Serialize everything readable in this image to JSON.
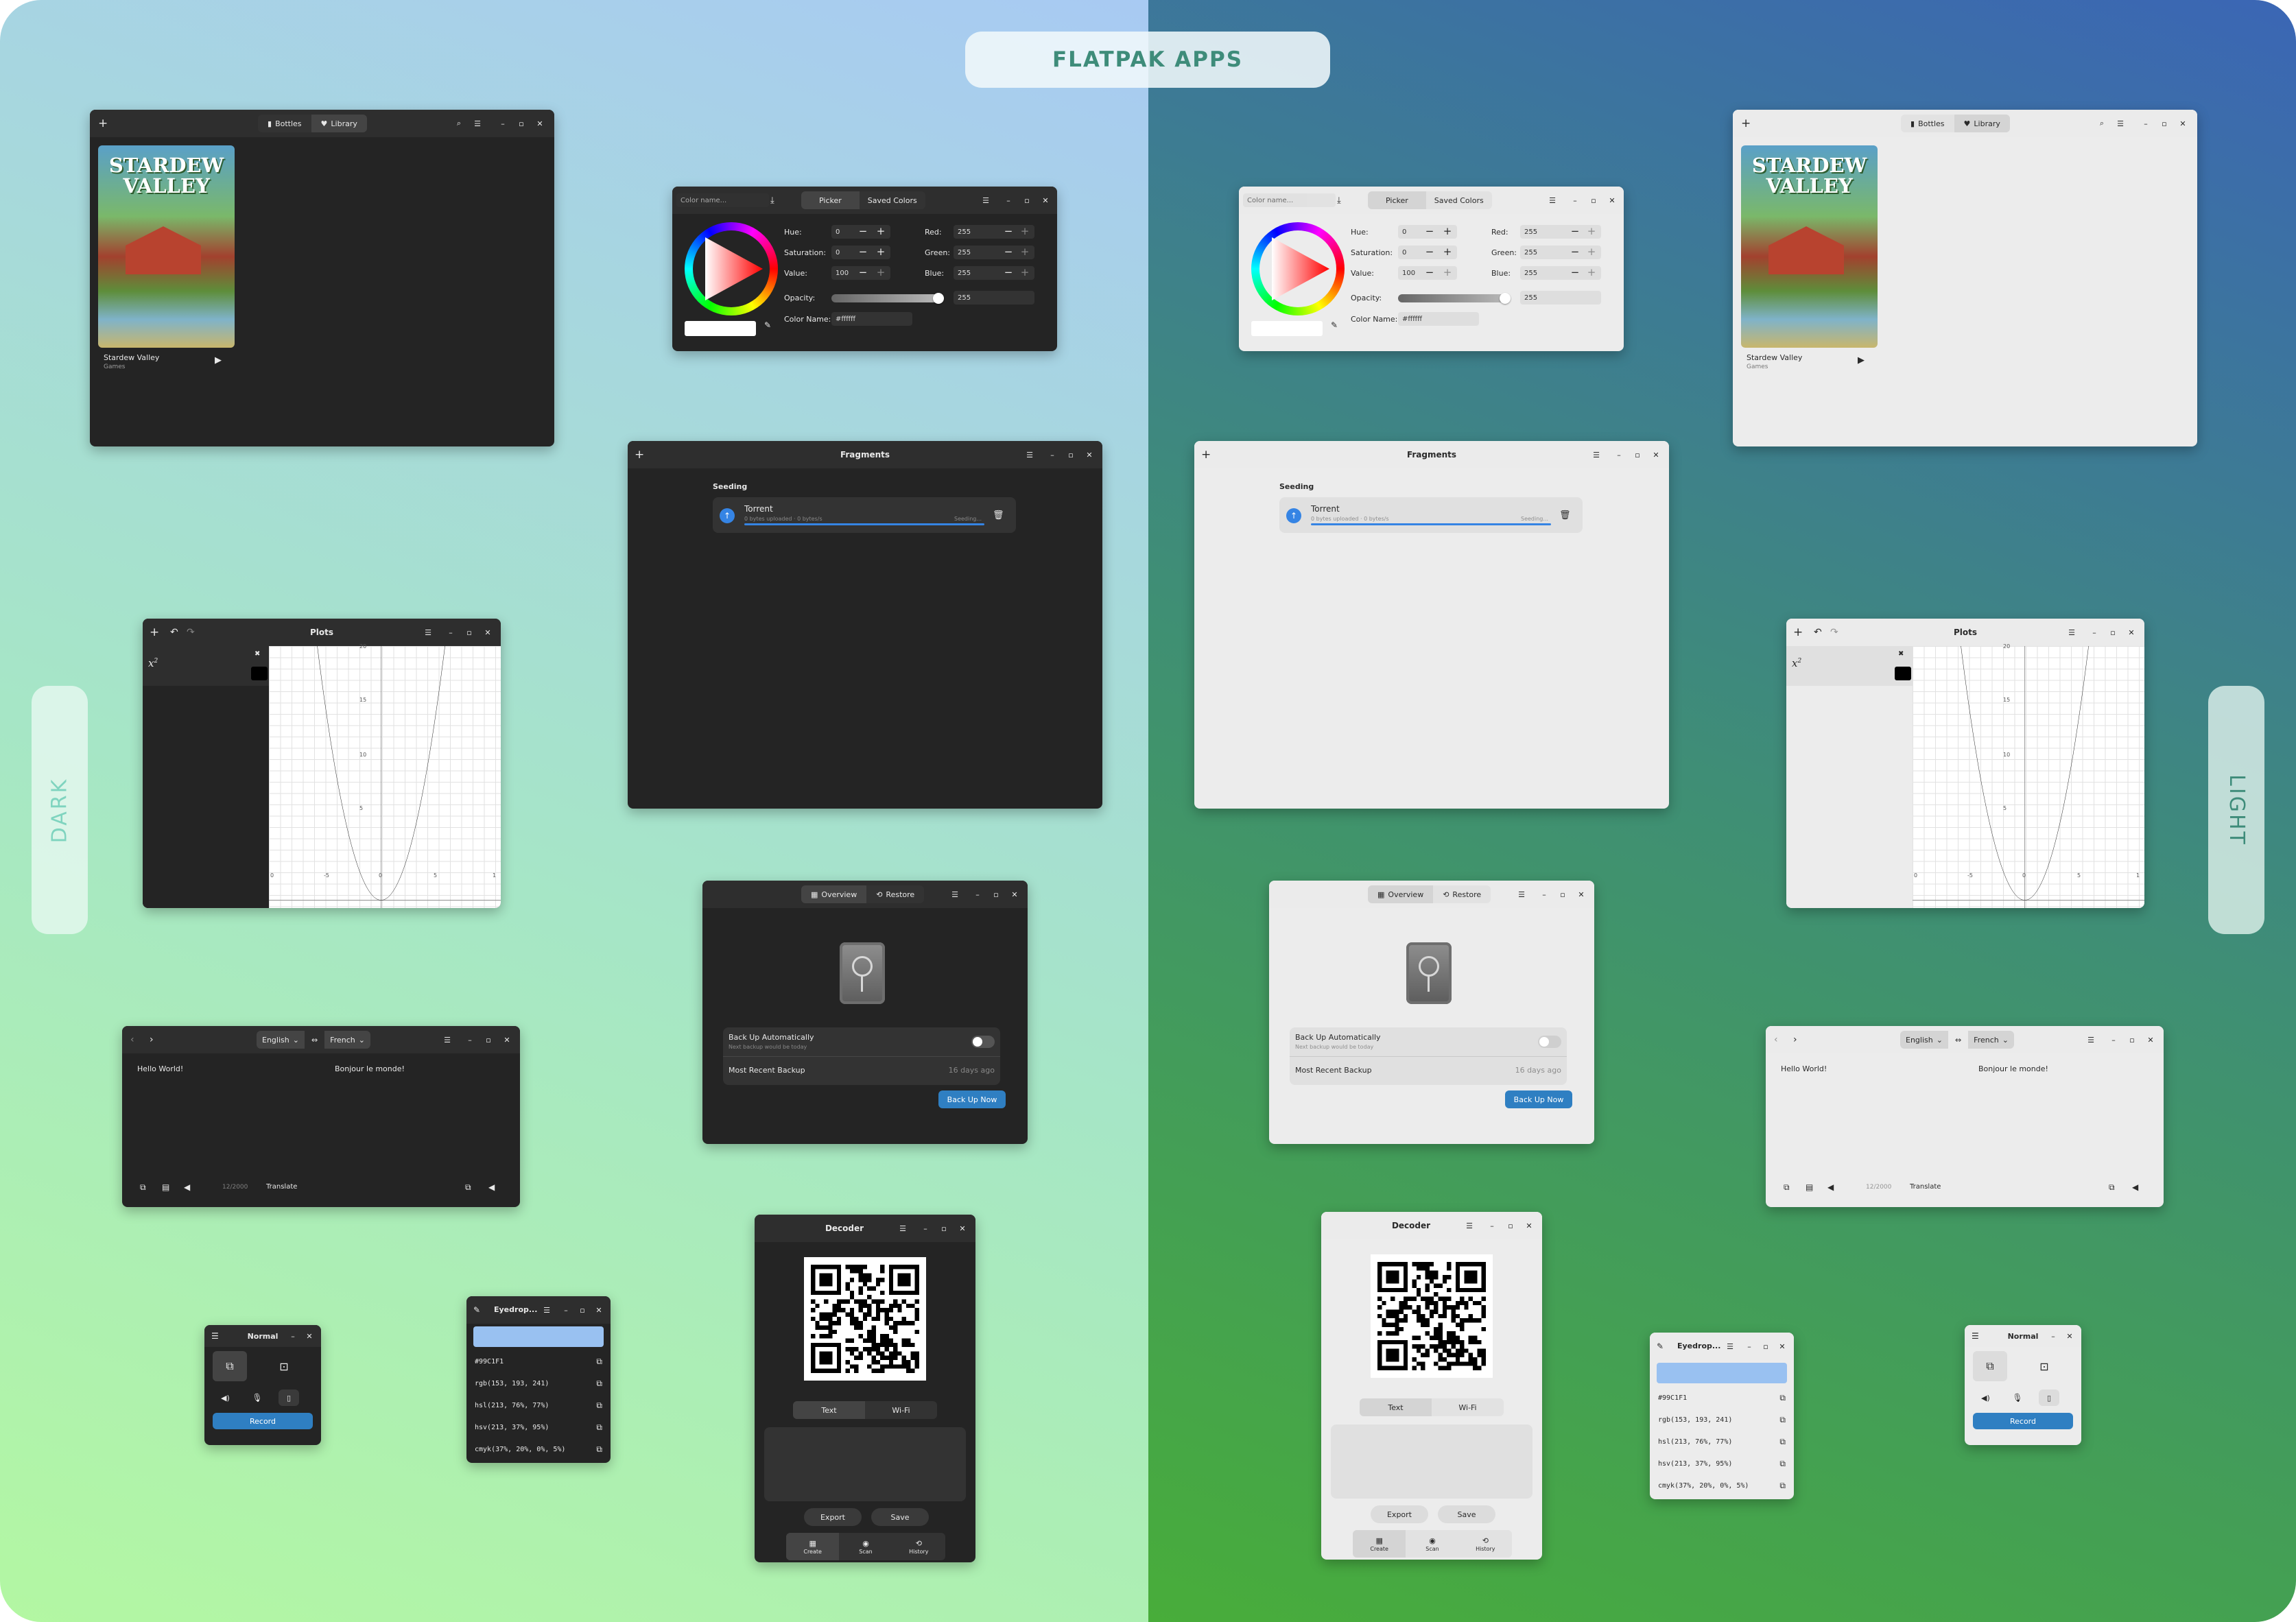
{
  "header": {
    "title": "FLATPAK APPS",
    "dark_label": "DARK",
    "light_label": "LIGHT"
  },
  "colors": {
    "accent": "#3584e4",
    "record": "#2f7fc2",
    "eyedropper_swatch": "#99c1f1",
    "dark_bg": "#242424",
    "light_bg": "#ececec"
  },
  "bottles": {
    "tab_bottles": "Bottles",
    "tab_library": "Library",
    "cover_line1": "STARDEW",
    "cover_line2": "VALLEY",
    "game_name": "Stardew Valley",
    "game_category": "Games",
    "play_icon": "play-icon"
  },
  "picker": {
    "placeholder": "Color name...",
    "tab_picker": "Picker",
    "tab_saved": "Saved Colors",
    "hue_label": "Hue:",
    "hue": "0",
    "sat_label": "Saturation:",
    "sat": "0",
    "val_label": "Value:",
    "val": "100",
    "red_label": "Red:",
    "red": "255",
    "green_label": "Green:",
    "green": "255",
    "blue_label": "Blue:",
    "blue": "255",
    "opacity_label": "Opacity:",
    "opacity": "255",
    "colorname_label": "Color Name:",
    "colorname": "#ffffff"
  },
  "fragments": {
    "title": "Fragments",
    "section": "Seeding",
    "item": "Torrent",
    "sub": "0 bytes uploaded · 0 bytes/s",
    "status": "Seeding..."
  },
  "plots": {
    "title": "Plots",
    "formula": "x",
    "exp": "2",
    "y_ticks": [
      "20",
      "15",
      "10",
      "5"
    ],
    "x_ticks": [
      "0",
      "-5",
      "0",
      "5",
      "1"
    ]
  },
  "backup": {
    "tab_overview": "Overview",
    "tab_restore": "Restore",
    "auto_label": "Back Up Automatically",
    "auto_sub": "Next backup would be today",
    "recent_label": "Most Recent Backup",
    "recent_value": "16 days ago",
    "button": "Back Up Now"
  },
  "translate": {
    "from": "English",
    "to": "French",
    "source": "Hello World!",
    "target": "Bonjour le monde!",
    "count": "12/2000",
    "button": "Translate"
  },
  "decoder": {
    "title": "Decoder",
    "tab_text": "Text",
    "tab_wifi": "Wi-Fi",
    "export": "Export",
    "save": "Save",
    "nav_create": "Create",
    "nav_scan": "Scan",
    "nav_history": "History"
  },
  "eyedropper": {
    "title": "Eyedrop...",
    "hex": "#99C1F1",
    "rgb": "rgb(153, 193, 241)",
    "hsl": "hsl(213, 76%, 77%)",
    "hsv": "hsv(213, 37%, 95%)",
    "cmyk": "cmyk(37%, 20%, 0%, 5%)"
  },
  "recorder": {
    "mode": "Normal",
    "record": "Record"
  }
}
